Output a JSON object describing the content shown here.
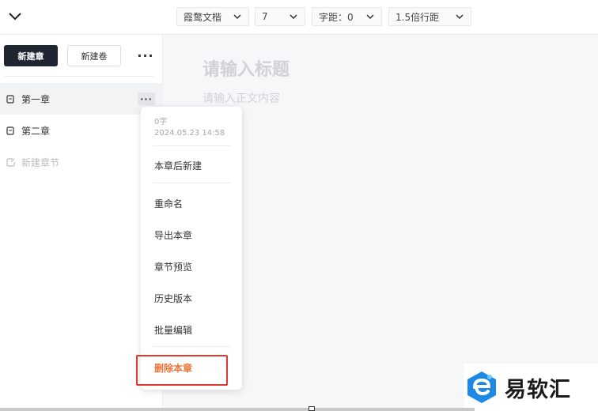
{
  "toolbar": {
    "font_family": "霞鹜文楷",
    "font_size": "7",
    "letter_spacing": "字距：0",
    "line_spacing": "1.5倍行距"
  },
  "sidebar": {
    "new_chapter_label": "新建章",
    "new_volume_label": "新建卷",
    "more_label": "···",
    "chapters": [
      {
        "label": "第一章",
        "active": true
      },
      {
        "label": "第二章",
        "active": false
      }
    ],
    "new_section_label": "新建章节",
    "chapter_more_label": "···"
  },
  "editor": {
    "title_placeholder": "请输入标题",
    "body_placeholder": "请输入正文内容"
  },
  "context_menu": {
    "word_count": "0字",
    "timestamp": "2024.05.23 14:58",
    "items": {
      "new_after": "本章后新建",
      "rename": "重命名",
      "export": "导出本章",
      "preview": "章节预览",
      "history": "历史版本",
      "batch_edit": "批量编辑",
      "delete": "删除本章"
    }
  },
  "logo": {
    "text": "易软汇"
  },
  "colors": {
    "primary_dark": "#1f2632",
    "danger": "#e8743b",
    "highlight": "#e03a2f",
    "logo_blue": "#1e88e5"
  }
}
